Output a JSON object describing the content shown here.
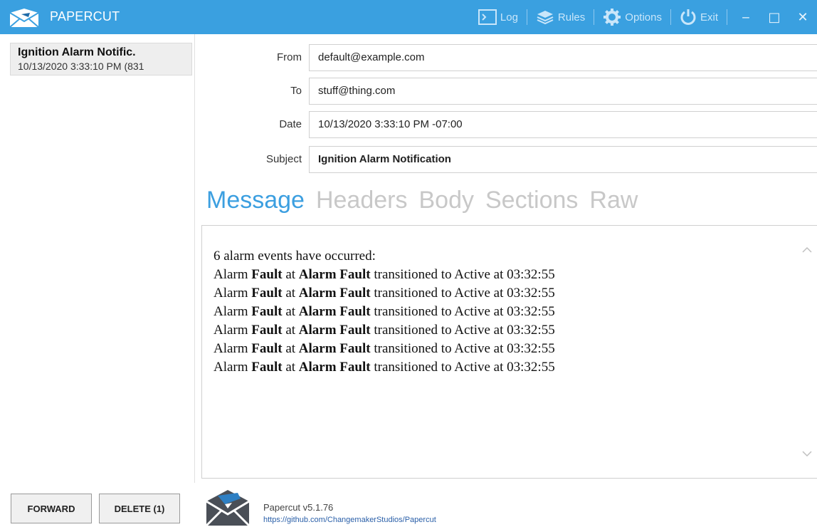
{
  "window": {
    "title": "PAPERCUT",
    "accent_color": "#3aa0e0",
    "icons": [
      "envelope-logo-icon",
      "log-icon",
      "rules-icon",
      "options-gear-icon",
      "power-icon",
      "minimize-icon",
      "maximize-icon",
      "close-icon"
    ]
  },
  "toolbar": {
    "log_label": "Log",
    "rules_label": "Rules",
    "options_label": "Options",
    "exit_label": "Exit",
    "minimize": "‒",
    "maximize": "□",
    "close": "✕"
  },
  "message_list": [
    {
      "subject": "Ignition Alarm Notific.",
      "date": "10/13/2020 3:33:10 PM (831"
    }
  ],
  "headers": {
    "from_label": "From",
    "from_value": "default@example.com",
    "to_label": "To",
    "to_value": "stuff@thing.com",
    "date_label": "Date",
    "date_value": "10/13/2020 3:33:10 PM -07:00",
    "subject_label": "Subject",
    "subject_value": "Ignition Alarm Notification"
  },
  "tabs": [
    {
      "label": "Message",
      "active": true
    },
    {
      "label": "Headers",
      "active": false
    },
    {
      "label": "Body",
      "active": false
    },
    {
      "label": "Sections",
      "active": false
    },
    {
      "label": "Raw",
      "active": false
    }
  ],
  "body": {
    "intro": "6 alarm events have occurred:",
    "events": [
      {
        "pre": "Alarm ",
        "name": "Fault",
        "mid": " at ",
        "source": "Alarm Fault",
        "post": " transitioned to Active at 03:32:55"
      },
      {
        "pre": "Alarm ",
        "name": "Fault",
        "mid": " at ",
        "source": "Alarm Fault",
        "post": " transitioned to Active at 03:32:55"
      },
      {
        "pre": "Alarm ",
        "name": "Fault",
        "mid": " at ",
        "source": "Alarm Fault",
        "post": " transitioned to Active at 03:32:55"
      },
      {
        "pre": "Alarm ",
        "name": "Fault",
        "mid": " at ",
        "source": "Alarm Fault",
        "post": " transitioned to Active at 03:32:55"
      },
      {
        "pre": "Alarm ",
        "name": "Fault",
        "mid": " at ",
        "source": "Alarm Fault",
        "post": " transitioned to Active at 03:32:55"
      },
      {
        "pre": "Alarm ",
        "name": "Fault",
        "mid": " at ",
        "source": "Alarm Fault",
        "post": " transitioned to Active at 03:32:55"
      }
    ]
  },
  "actions": {
    "forward_label": "FORWARD",
    "delete_label": "DELETE (1)"
  },
  "footer": {
    "version": "Papercut v5.1.76",
    "link": "https://github.com/ChangemakerStudios/Papercut"
  }
}
